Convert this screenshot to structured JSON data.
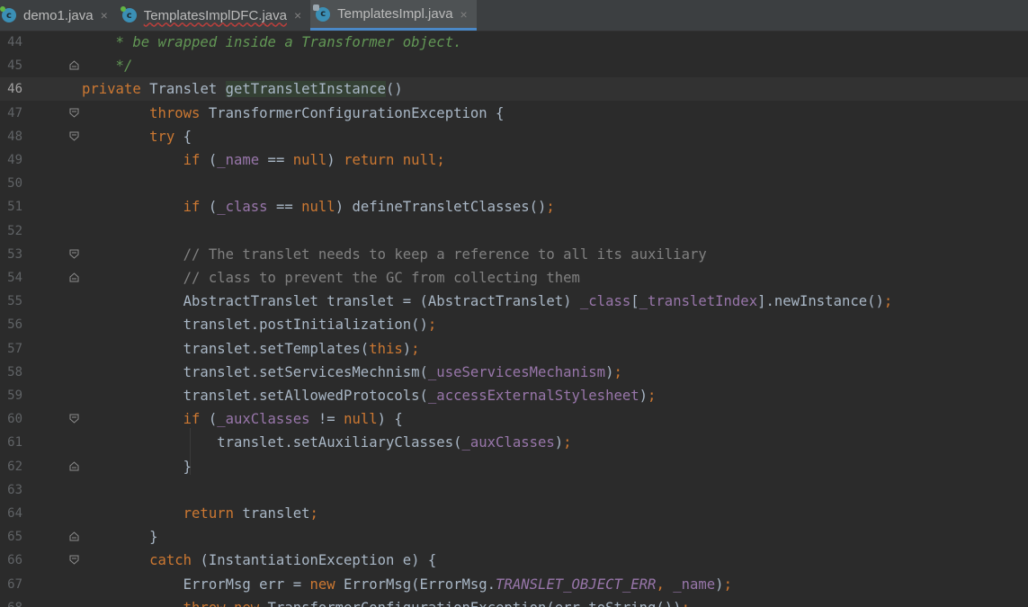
{
  "tabs": [
    {
      "name": "demo1.java",
      "icon": "java-class-icon",
      "active": false,
      "squiggle": false
    },
    {
      "name": "TemplatesImplDFC.java",
      "icon": "java-class-icon",
      "active": false,
      "squiggle": true
    },
    {
      "name": "TemplatesImpl.java",
      "icon": "java-class-locked-icon",
      "active": true,
      "squiggle": false
    }
  ],
  "tab_close_glyph": "×",
  "colors": {
    "background": "#2b2b2b",
    "keyword": "#cc7832",
    "field": "#9876aa",
    "comment": "#808080",
    "doc_comment": "#629755",
    "text": "#a9b7c6"
  },
  "code_lines": [
    {
      "n": "44",
      "fold": "",
      "segments": [
        [
          "doc",
          "    * be wrapped inside a Transformer object."
        ]
      ]
    },
    {
      "n": "45",
      "fold": "end",
      "segments": [
        [
          "doc",
          "    */"
        ]
      ]
    },
    {
      "n": "46",
      "fold": "",
      "current": true,
      "segments": [
        [
          "kw",
          "private "
        ],
        [
          "",
          "Translet "
        ],
        [
          "hl",
          "getTransletInstance"
        ],
        [
          "",
          "()"
        ]
      ]
    },
    {
      "n": "47",
      "fold": "start",
      "segments": [
        [
          "kw",
          "        throws "
        ],
        [
          "",
          "TransformerConfigurationException {"
        ]
      ]
    },
    {
      "n": "48",
      "fold": "start",
      "segments": [
        [
          "kw",
          "        try "
        ],
        [
          "",
          "{"
        ]
      ]
    },
    {
      "n": "49",
      "fold": "",
      "segments": [
        [
          "kw",
          "            if "
        ],
        [
          "",
          "("
        ],
        [
          "fld",
          "_name"
        ],
        [
          "",
          " == "
        ],
        [
          "kw",
          "null"
        ],
        [
          "",
          ") "
        ],
        [
          "kw",
          "return null;"
        ]
      ]
    },
    {
      "n": "50",
      "fold": "",
      "segments": [
        [
          "",
          ""
        ]
      ]
    },
    {
      "n": "51",
      "fold": "",
      "segments": [
        [
          "kw",
          "            if "
        ],
        [
          "",
          "("
        ],
        [
          "fld",
          "_class"
        ],
        [
          "",
          " == "
        ],
        [
          "kw",
          "null"
        ],
        [
          "",
          ") defineTransletClasses()"
        ],
        [
          "kw",
          ";"
        ]
      ]
    },
    {
      "n": "52",
      "fold": "",
      "segments": [
        [
          "",
          ""
        ]
      ]
    },
    {
      "n": "53",
      "fold": "start",
      "segments": [
        [
          "cmt",
          "            // The translet needs to keep a reference to all its auxiliary"
        ]
      ]
    },
    {
      "n": "54",
      "fold": "end",
      "segments": [
        [
          "cmt",
          "            // class to prevent the GC from collecting them"
        ]
      ]
    },
    {
      "n": "55",
      "fold": "",
      "segments": [
        [
          "",
          "            AbstractTranslet translet = (AbstractTranslet) "
        ],
        [
          "fld",
          "_class"
        ],
        [
          "",
          "["
        ],
        [
          "fld",
          "_transletIndex"
        ],
        [
          "",
          "].newInstance()"
        ],
        [
          "kw",
          ";"
        ]
      ]
    },
    {
      "n": "56",
      "fold": "",
      "segments": [
        [
          "",
          "            translet.postInitialization()"
        ],
        [
          "kw",
          ";"
        ]
      ]
    },
    {
      "n": "57",
      "fold": "",
      "segments": [
        [
          "",
          "            translet.setTemplates("
        ],
        [
          "kw",
          "this"
        ],
        [
          "",
          ")"
        ],
        [
          "kw",
          ";"
        ]
      ]
    },
    {
      "n": "58",
      "fold": "",
      "segments": [
        [
          "",
          "            translet.setServicesMechnism("
        ],
        [
          "fld",
          "_useServicesMechanism"
        ],
        [
          "",
          ")"
        ],
        [
          "kw",
          ";"
        ]
      ]
    },
    {
      "n": "59",
      "fold": "",
      "segments": [
        [
          "",
          "            translet.setAllowedProtocols("
        ],
        [
          "fld",
          "_accessExternalStylesheet"
        ],
        [
          "",
          ")"
        ],
        [
          "kw",
          ";"
        ]
      ]
    },
    {
      "n": "60",
      "fold": "start",
      "segments": [
        [
          "kw",
          "            if "
        ],
        [
          "",
          "("
        ],
        [
          "fld",
          "_auxClasses"
        ],
        [
          "",
          " != "
        ],
        [
          "kw",
          "null"
        ],
        [
          "",
          ") {"
        ]
      ]
    },
    {
      "n": "61",
      "fold": "",
      "segments": [
        [
          "",
          "                translet.setAuxiliaryClasses("
        ],
        [
          "fld",
          "_auxClasses"
        ],
        [
          "",
          ")"
        ],
        [
          "kw",
          ";"
        ]
      ]
    },
    {
      "n": "62",
      "fold": "end",
      "segments": [
        [
          "",
          "            }"
        ]
      ]
    },
    {
      "n": "63",
      "fold": "",
      "segments": [
        [
          "",
          ""
        ]
      ]
    },
    {
      "n": "64",
      "fold": "",
      "segments": [
        [
          "kw",
          "            return "
        ],
        [
          "",
          "translet"
        ],
        [
          "kw",
          ";"
        ]
      ]
    },
    {
      "n": "65",
      "fold": "end",
      "segments": [
        [
          "",
          "        }"
        ]
      ]
    },
    {
      "n": "66",
      "fold": "start",
      "segments": [
        [
          "kw",
          "        catch "
        ],
        [
          "",
          "(InstantiationException e) {"
        ]
      ]
    },
    {
      "n": "67",
      "fold": "",
      "segments": [
        [
          "",
          "            ErrorMsg err = "
        ],
        [
          "kw",
          "new "
        ],
        [
          "",
          "ErrorMsg(ErrorMsg."
        ],
        [
          "st",
          "TRANSLET_OBJECT_ERR"
        ],
        [
          "kw",
          ", "
        ],
        [
          "fld",
          "_name"
        ],
        [
          "",
          ")"
        ],
        [
          "kw",
          ";"
        ]
      ]
    },
    {
      "n": "68",
      "fold": "",
      "segments": [
        [
          "kw",
          "            throw new "
        ],
        [
          "",
          "TransformerConfigurationException(err.toString())"
        ],
        [
          "kw",
          ";"
        ]
      ]
    }
  ]
}
